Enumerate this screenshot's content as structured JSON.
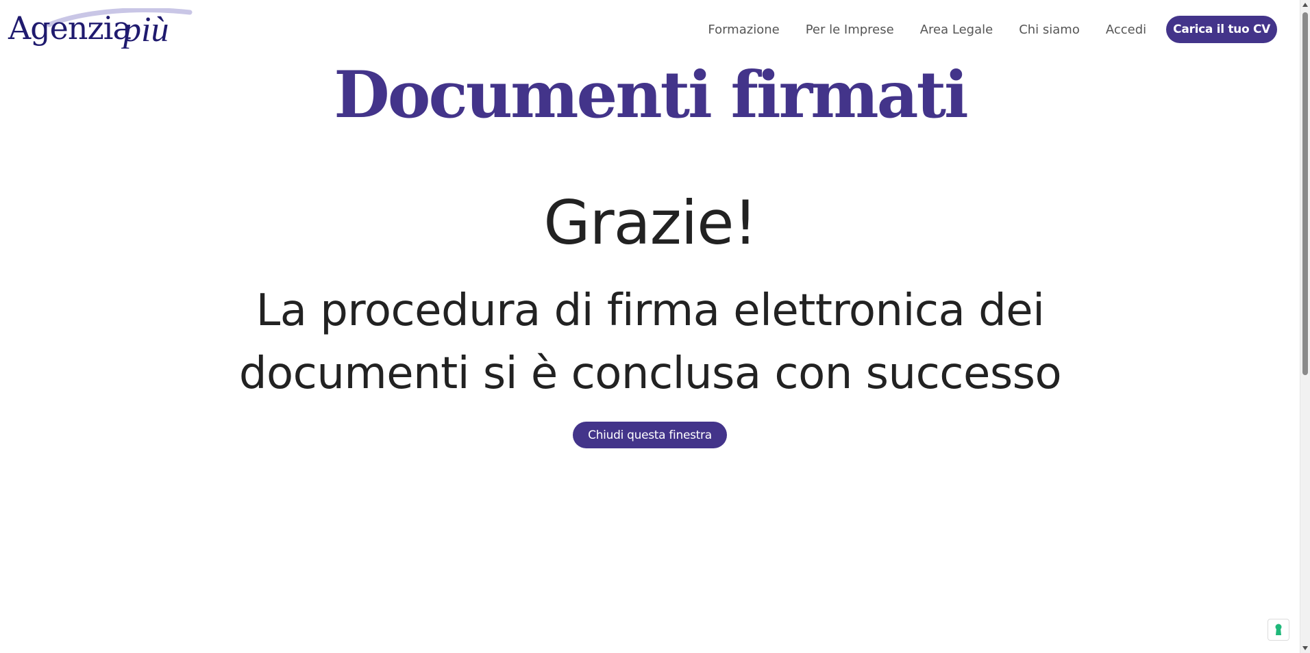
{
  "header": {
    "logo": {
      "main": "Agenzia",
      "script": "più"
    },
    "nav": [
      {
        "label": "Formazione"
      },
      {
        "label": "Per le Imprese"
      },
      {
        "label": "Area Legale"
      },
      {
        "label": "Chi siamo"
      },
      {
        "label": "Accedi"
      }
    ],
    "cta_label": "Carica il tuo CV"
  },
  "main": {
    "title": "Documenti firmati",
    "thanks": "Grazie!",
    "message_line1": "La procedura di firma elettronica dei",
    "message_line2": "documenti si è conclusa con successo",
    "close_label": "Chiudi questa finestra"
  },
  "icons": {
    "cookie_badge": "keyhole-icon"
  },
  "colors": {
    "brand": "#43348a",
    "logo": "#1f1a6e",
    "text": "#222222",
    "nav_text": "#555555",
    "badge_icon": "#1fb87a"
  }
}
